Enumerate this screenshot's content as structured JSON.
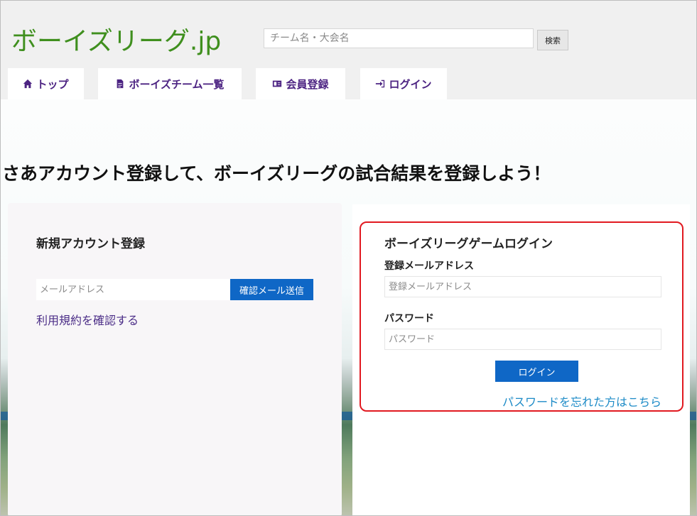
{
  "brand": {
    "logo": "ボーイズリーグ.jp"
  },
  "search": {
    "placeholder": "チーム名・大会名",
    "button_label": "検索"
  },
  "nav": {
    "items": [
      {
        "label": "トップ",
        "icon": "home-icon"
      },
      {
        "label": "ボーイズチーム一覧",
        "icon": "document-icon"
      },
      {
        "label": "会員登録",
        "icon": "id-card-icon"
      },
      {
        "label": "ログイン",
        "icon": "sign-in-icon"
      }
    ]
  },
  "headline": "さあアカウント登録して、ボーイズリーグの試合結果を登録しよう！",
  "signup": {
    "title": "新規アカウント登録",
    "email_placeholder": "メールアドレス",
    "send_button": "確認メール送信",
    "terms_link": "利用規約を確認する"
  },
  "login": {
    "title": "ボーイズリーグゲームログイン",
    "email_label": "登録メールアドレス",
    "email_placeholder": "登録メールアドレス",
    "password_label": "パスワード",
    "password_placeholder": "パスワード",
    "button": "ログイン",
    "forgot_link": "パスワードを忘れた方はこちら"
  },
  "colors": {
    "brand_green": "#3f8f1e",
    "nav_purple": "#4c2382",
    "primary_blue": "#0f67c6",
    "highlight_red": "#e11920",
    "link_blue": "#1d8bc7"
  }
}
